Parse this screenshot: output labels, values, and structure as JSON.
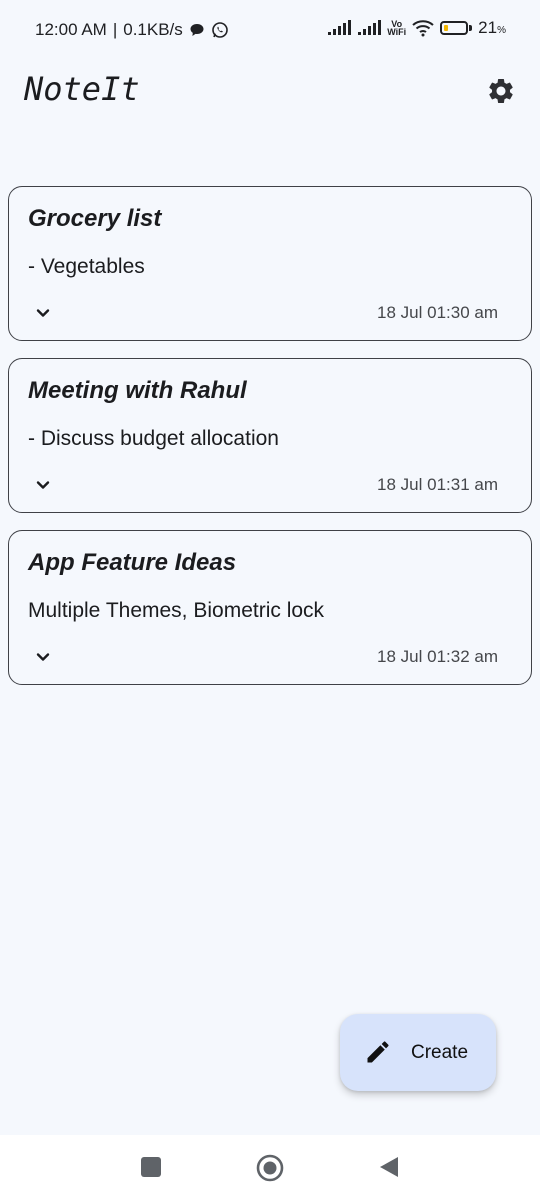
{
  "status_bar": {
    "time": "12:00 AM",
    "separator": "|",
    "network_speed": "0.1KB/s",
    "notification_icons": [
      "chat-bubble-icon",
      "whatsapp-icon"
    ],
    "vowifi_top": "Vo",
    "vowifi_bottom": "WiFi",
    "battery_percent": "21",
    "battery_unit": "%",
    "battery_level": 0.21,
    "battery_fill_color": "#f2b600"
  },
  "app_bar": {
    "title": "NoteIt",
    "settings_icon": "gear-icon"
  },
  "notes": [
    {
      "title": "Grocery list",
      "body": "- Vegetables",
      "timestamp": "18 Jul 01:30 am"
    },
    {
      "title": "Meeting with Rahul",
      "body": "- Discuss budget allocation",
      "timestamp": "18 Jul 01:31 am"
    },
    {
      "title": "App Feature Ideas",
      "body": "Multiple Themes, Biometric lock",
      "timestamp": "18 Jul 01:32 am"
    }
  ],
  "fab": {
    "label": "Create",
    "icon": "pencil-icon",
    "background": "#d7e3fb"
  },
  "nav_bar": {
    "recents_icon": "square-icon",
    "home_icon": "circle-home-icon",
    "back_icon": "triangle-back-icon"
  }
}
